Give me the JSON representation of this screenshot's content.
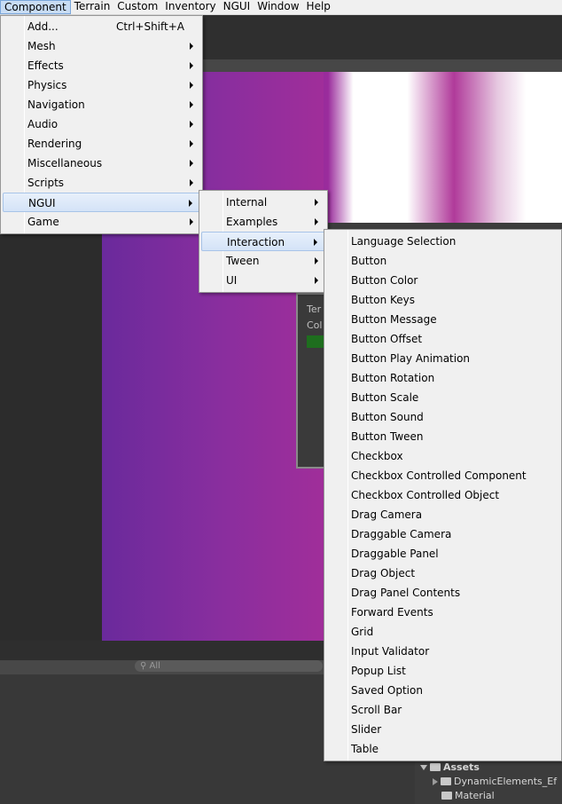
{
  "menubar": {
    "items": [
      {
        "label": "Component",
        "active": true
      },
      {
        "label": "Terrain"
      },
      {
        "label": "Custom"
      },
      {
        "label": "Inventory"
      },
      {
        "label": "NGUI"
      },
      {
        "label": "Window"
      },
      {
        "label": "Help"
      }
    ]
  },
  "component_menu": {
    "items": [
      {
        "label": "Add...",
        "shortcut": "Ctrl+Shift+A"
      },
      {
        "label": "Mesh",
        "submenu": true
      },
      {
        "label": "Effects",
        "submenu": true
      },
      {
        "label": "Physics",
        "submenu": true
      },
      {
        "label": "Navigation",
        "submenu": true
      },
      {
        "label": "Audio",
        "submenu": true
      },
      {
        "label": "Rendering",
        "submenu": true
      },
      {
        "label": "Miscellaneous",
        "submenu": true
      },
      {
        "label": "Scripts",
        "submenu": true
      },
      {
        "label": "NGUI",
        "submenu": true,
        "highlighted": true
      },
      {
        "label": "Game",
        "submenu": true
      }
    ]
  },
  "ngui_menu": {
    "items": [
      {
        "label": "Internal",
        "submenu": true
      },
      {
        "label": "Examples",
        "submenu": true
      },
      {
        "label": "Interaction",
        "submenu": true,
        "highlighted": true
      },
      {
        "label": "Tween",
        "submenu": true
      },
      {
        "label": "UI",
        "submenu": true
      }
    ]
  },
  "interaction_menu": {
    "items": [
      "Language Selection",
      "Button",
      "Button Color",
      "Button Keys",
      "Button Message",
      "Button Offset",
      "Button Play Animation",
      "Button Rotation",
      "Button Scale",
      "Button Sound",
      "Button Tween",
      "Checkbox",
      "Checkbox Controlled Component",
      "Checkbox Controlled Object",
      "Drag Camera",
      "Draggable Camera",
      "Draggable Panel",
      "Drag Object",
      "Drag Panel Contents",
      "Forward Events",
      "Grid",
      "Input Validator",
      "Popup List",
      "Saved Option",
      "Scroll Bar",
      "Slider",
      "Table"
    ]
  },
  "editor": {
    "overlay_label_1": "Ter",
    "overlay_label_2": "Col",
    "search_placeholder": "All",
    "search_icon": "search-icon",
    "project": {
      "root": "Assets",
      "children": [
        "DynamicElements_Ef",
        "Material"
      ]
    }
  }
}
